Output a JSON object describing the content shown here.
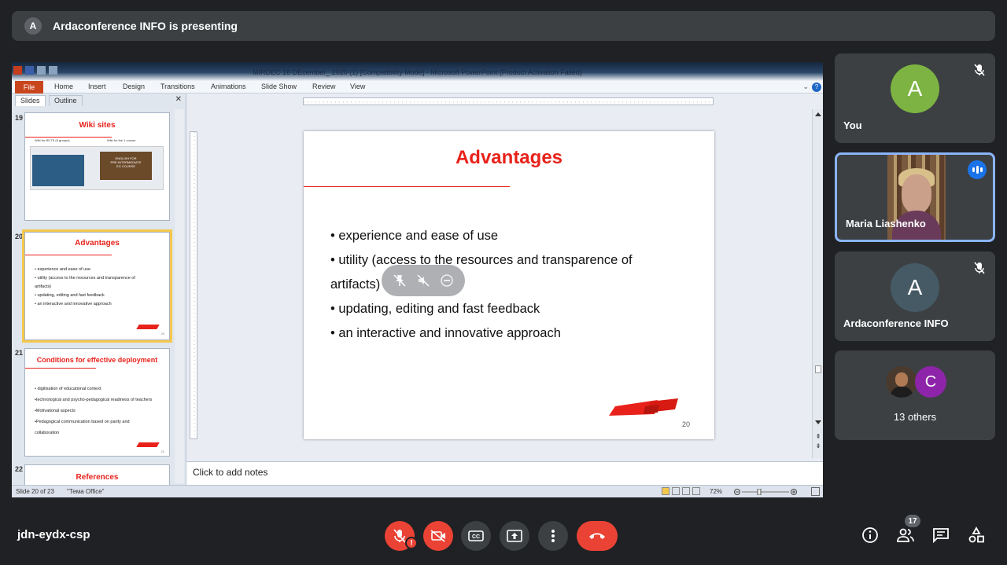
{
  "banner": {
    "avatar_letter": "A",
    "text": "Ardaconference INFO is presenting"
  },
  "powerpoint": {
    "window_title": "MIRDEC 16 DEcember_ 2020 (1) [Compatibility Mode] - Microsoft PowerPoint (Product Activation Failed)",
    "ribbon_tabs": [
      "File",
      "Home",
      "Insert",
      "Design",
      "Transitions",
      "Animations",
      "Slide Show",
      "Review",
      "View"
    ],
    "panel_tabs": [
      "Slides",
      "Outline"
    ],
    "thumbnails": [
      {
        "number": "19",
        "title": "Wiki sites",
        "captions": [
          "Wiki for IELTS (9 groups)",
          "Wiki for the 1 course"
        ],
        "image_text": "ENGLISH FOR\nPRE-INTERMEDIATE\nEG COURSE"
      },
      {
        "number": "20",
        "title": "Advantages",
        "body": "• experience and ease of use\n• utility (access to the resources and transparence of artifacts)\n• updating, editing and fast feedback\n• an interactive and innovative approach"
      },
      {
        "number": "21",
        "title": "Conditions for effective deployment",
        "body": "• digitisation of educational context\n•technological and psycho-pedagogical readiness of teachers\n•Motivational aspects\n•Pedagogical communication based on parity and collaboration"
      },
      {
        "number": "22",
        "title": "References"
      }
    ],
    "current_slide": {
      "title": "Advantages",
      "bullets": [
        "• experience and ease of use",
        "• utility (access to the resources and transparence of artifacts)",
        "• updating, editing and fast feedback",
        "• an interactive and innovative approach"
      ],
      "page_number": "20"
    },
    "notes_placeholder": "Click to add notes",
    "status": {
      "slide_info": "Slide 20 of 23",
      "theme": "\"Тема Office\"",
      "zoom": "72%"
    }
  },
  "participants": [
    {
      "name": "You",
      "letter": "A",
      "color": "#7cb342",
      "muted": true
    },
    {
      "name": "Maria Liashenko",
      "speaking": true
    },
    {
      "name": "Ardaconference INFO",
      "letter": "A",
      "color": "#455a64",
      "muted": true
    },
    {
      "name": "13 others",
      "letter": "C",
      "color": "#8e24aa"
    }
  ],
  "meeting": {
    "code": "jdn-eydx-csp",
    "participant_count": "17",
    "warning_badge": "!"
  }
}
